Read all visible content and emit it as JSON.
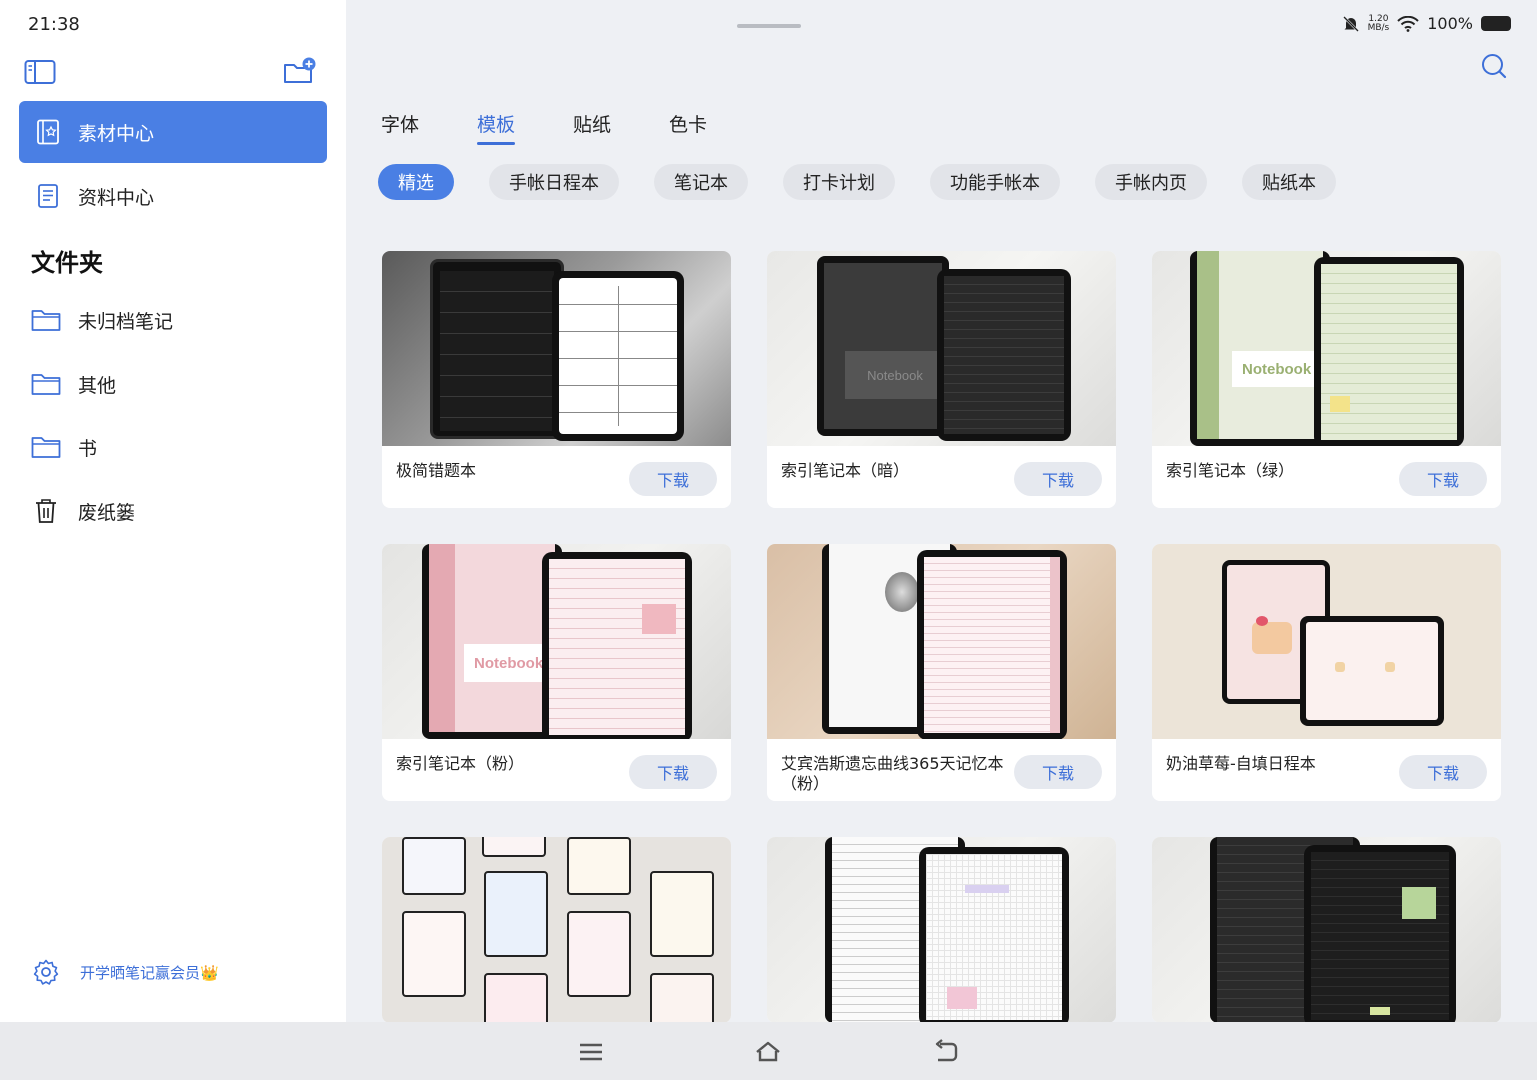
{
  "status": {
    "time": "21:38",
    "net_speed_top": "1.20",
    "net_speed_unit": "MB/s",
    "battery": "100%"
  },
  "sidebar": {
    "nav": [
      {
        "label": "素材中心",
        "icon": "material-book-icon",
        "active": true
      },
      {
        "label": "资料中心",
        "icon": "document-icon",
        "active": false
      }
    ],
    "folder_title": "文件夹",
    "folders": [
      {
        "label": "未归档笔记",
        "icon": "folder-icon"
      },
      {
        "label": "其他",
        "icon": "folder-icon"
      },
      {
        "label": "书",
        "icon": "folder-icon"
      },
      {
        "label": "废纸篓",
        "icon": "trash-icon"
      }
    ],
    "promo": "开学晒笔记赢会员👑"
  },
  "tabs": [
    "字体",
    "模板",
    "贴纸",
    "色卡"
  ],
  "active_tab": "模板",
  "chips": [
    "精选",
    "手帐日程本",
    "笔记本",
    "打卡计划",
    "功能手帐本",
    "手帐内页",
    "贴纸本"
  ],
  "active_chip": "精选",
  "download_label": "下载",
  "cards": [
    {
      "title": "极简错题本",
      "theme": "gray-stone"
    },
    {
      "title": "索引笔记本（暗）",
      "theme": "dark"
    },
    {
      "title": "索引笔记本（绿）",
      "theme": "green"
    },
    {
      "title": "索引笔记本（粉）",
      "theme": "pink"
    },
    {
      "title": "艾宾浩斯遗忘曲线365天记忆本（粉）",
      "theme": "wood-pink"
    },
    {
      "title": "奶油草莓-自填日程本",
      "theme": "cream"
    },
    {
      "title": "",
      "theme": "pastel-pages"
    },
    {
      "title": "",
      "theme": "grid-notes"
    },
    {
      "title": "",
      "theme": "dark-notes"
    }
  ],
  "cover_text": {
    "notebook": "Notebook"
  },
  "colors": {
    "accent": "#4a7fe4",
    "link": "#3d6fd8",
    "chip_bg": "#e2e4e9",
    "bg": "#eef0f4"
  }
}
